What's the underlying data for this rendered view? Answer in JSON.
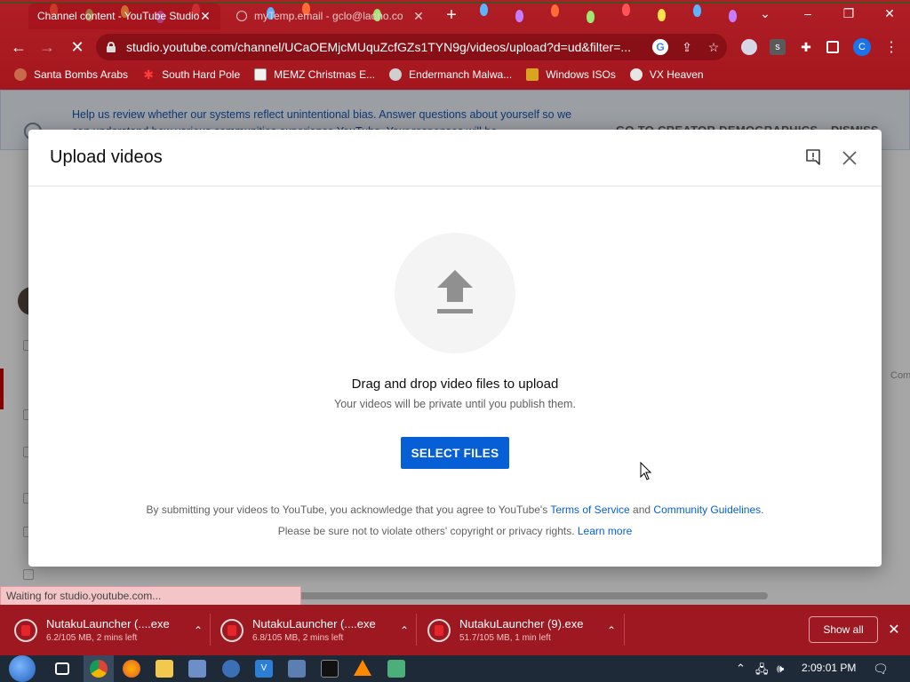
{
  "browser": {
    "tabs": [
      {
        "title": "Channel content - YouTube Studio",
        "active": true
      },
      {
        "title": "myTemp.email - gclo@laoho.co",
        "active": false
      }
    ],
    "url": "studio.youtube.com/channel/UCaOEMjcMUquZcfGZs1TYN9g/videos/upload?d=ud&filter=...",
    "profile_initial": "C",
    "extension_letter": "s",
    "bookmarks": [
      {
        "label": "Santa Bombs Arabs",
        "icon": "santa-icon"
      },
      {
        "label": "South Hard Pole",
        "icon": "red-star-icon"
      },
      {
        "label": "MEMZ Christmas E...",
        "icon": "memz-icon"
      },
      {
        "label": "Endermanch Malwa...",
        "icon": "endermanch-icon"
      },
      {
        "label": "Windows ISOs",
        "icon": "windows-iso-icon"
      },
      {
        "label": "VX Heaven",
        "icon": "vx-heaven-icon"
      }
    ],
    "status": "Waiting for studio.youtube.com..."
  },
  "page_behind": {
    "banner_text": "Help us review whether our systems reflect unintentional bias. Answer questions about yourself so we can understand how various communities experience YouTube. Your responses will be",
    "banner_cta": "GO TO CREATOR DEMOGRAPHICS",
    "banner_dismiss": "DISMISS",
    "right_fragment": "Com"
  },
  "modal": {
    "title": "Upload videos",
    "drag_title": "Drag and drop video files to upload",
    "drag_subtitle": "Your videos will be private until you publish them.",
    "select_button": "SELECT FILES",
    "legal_prefix": "By submitting your videos to YouTube, you acknowledge that you agree to YouTube's ",
    "terms_link": "Terms of Service",
    "legal_and": " and ",
    "guidelines_link": "Community Guidelines",
    "legal_end": ".",
    "copyright_text": "Please be sure not to violate others' copyright or privacy rights. ",
    "learn_more": "Learn more"
  },
  "downloads": {
    "items": [
      {
        "name": "NutakuLauncher (....exe",
        "meta": "6.2/105 MB, 2 mins left"
      },
      {
        "name": "NutakuLauncher (....exe",
        "meta": "6.8/105 MB, 2 mins left"
      },
      {
        "name": "NutakuLauncher (9).exe",
        "meta": "51.7/105 MB, 1 min left"
      }
    ],
    "show_all": "Show all"
  },
  "taskbar": {
    "clock": "2:09:01 PM"
  },
  "colors": {
    "chrome_theme": "#a4161d",
    "yt_blue": "#065fd4",
    "downloads_bar": "#9d1820",
    "taskbar": "#1e2a38"
  }
}
